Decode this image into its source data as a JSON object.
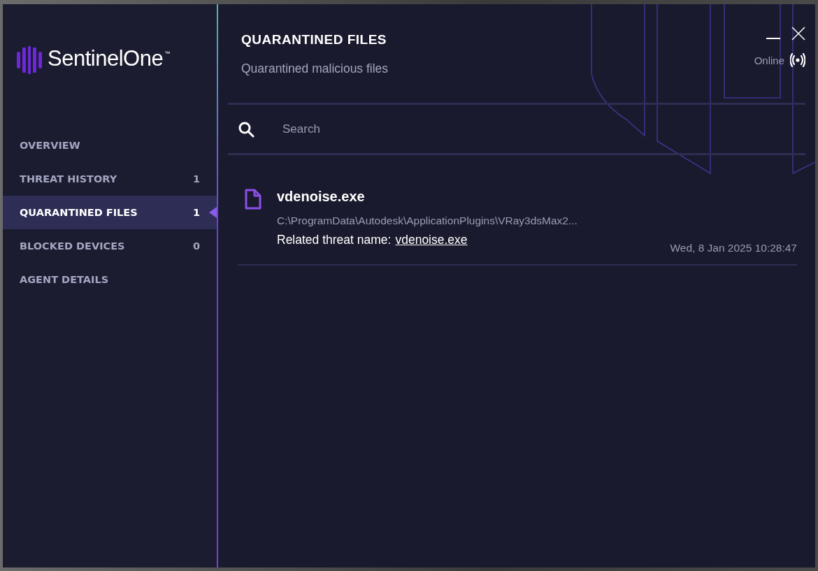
{
  "brand": {
    "name": "SentinelOne",
    "mark": "™"
  },
  "sidebar": {
    "items": [
      {
        "label": "OVERVIEW",
        "selected": false
      },
      {
        "label": "THREAT HISTORY",
        "count": "1",
        "selected": false
      },
      {
        "label": "QUARANTINED FILES",
        "count": "1",
        "selected": true
      },
      {
        "label": "BLOCKED DEVICES",
        "count": "0",
        "selected": false
      },
      {
        "label": "AGENT DETAILS",
        "selected": false
      }
    ]
  },
  "header": {
    "title": "QUARANTINED FILES",
    "subtitle": "Quarantined malicious files",
    "status": "Online"
  },
  "search": {
    "placeholder": "Search"
  },
  "files": [
    {
      "name": "vdenoise.exe",
      "path": "C:\\ProgramData\\Autodesk\\ApplicationPlugins\\VRay3dsMax2...",
      "threat_label": "Related threat name:",
      "threat_link": "vdenoise.exe",
      "date": "Wed, 8 Jan 2025 10:28:47"
    }
  ]
}
